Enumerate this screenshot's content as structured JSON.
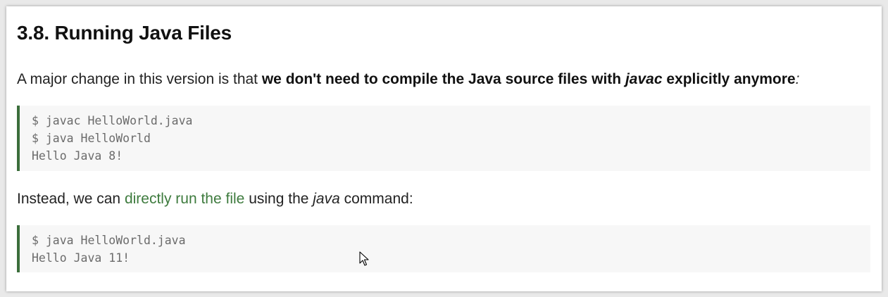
{
  "section": {
    "heading": "3.8. Running Java Files"
  },
  "intro": {
    "text_plain": "A major change in this version is that ",
    "bold_before": "we don't need to compile the Java source files with ",
    "bold_italic": "javac",
    "bold_after": " explicitly anymore",
    "italic_colon": ":"
  },
  "code_block_1": {
    "lines": [
      "$ javac HelloWorld.java",
      "$ java HelloWorld",
      "Hello Java 8!"
    ]
  },
  "after": {
    "text_before": "Instead, we can ",
    "link_text": "directly run the file",
    "text_middle": " using the ",
    "italic": "java",
    "text_after": " command:"
  },
  "code_block_2": {
    "lines": [
      "$ java HelloWorld.java",
      "Hello Java 11!"
    ]
  },
  "colors": {
    "link": "#3e7b3e",
    "code_border": "#3b6e3b",
    "code_background": "#f7f7f7"
  }
}
